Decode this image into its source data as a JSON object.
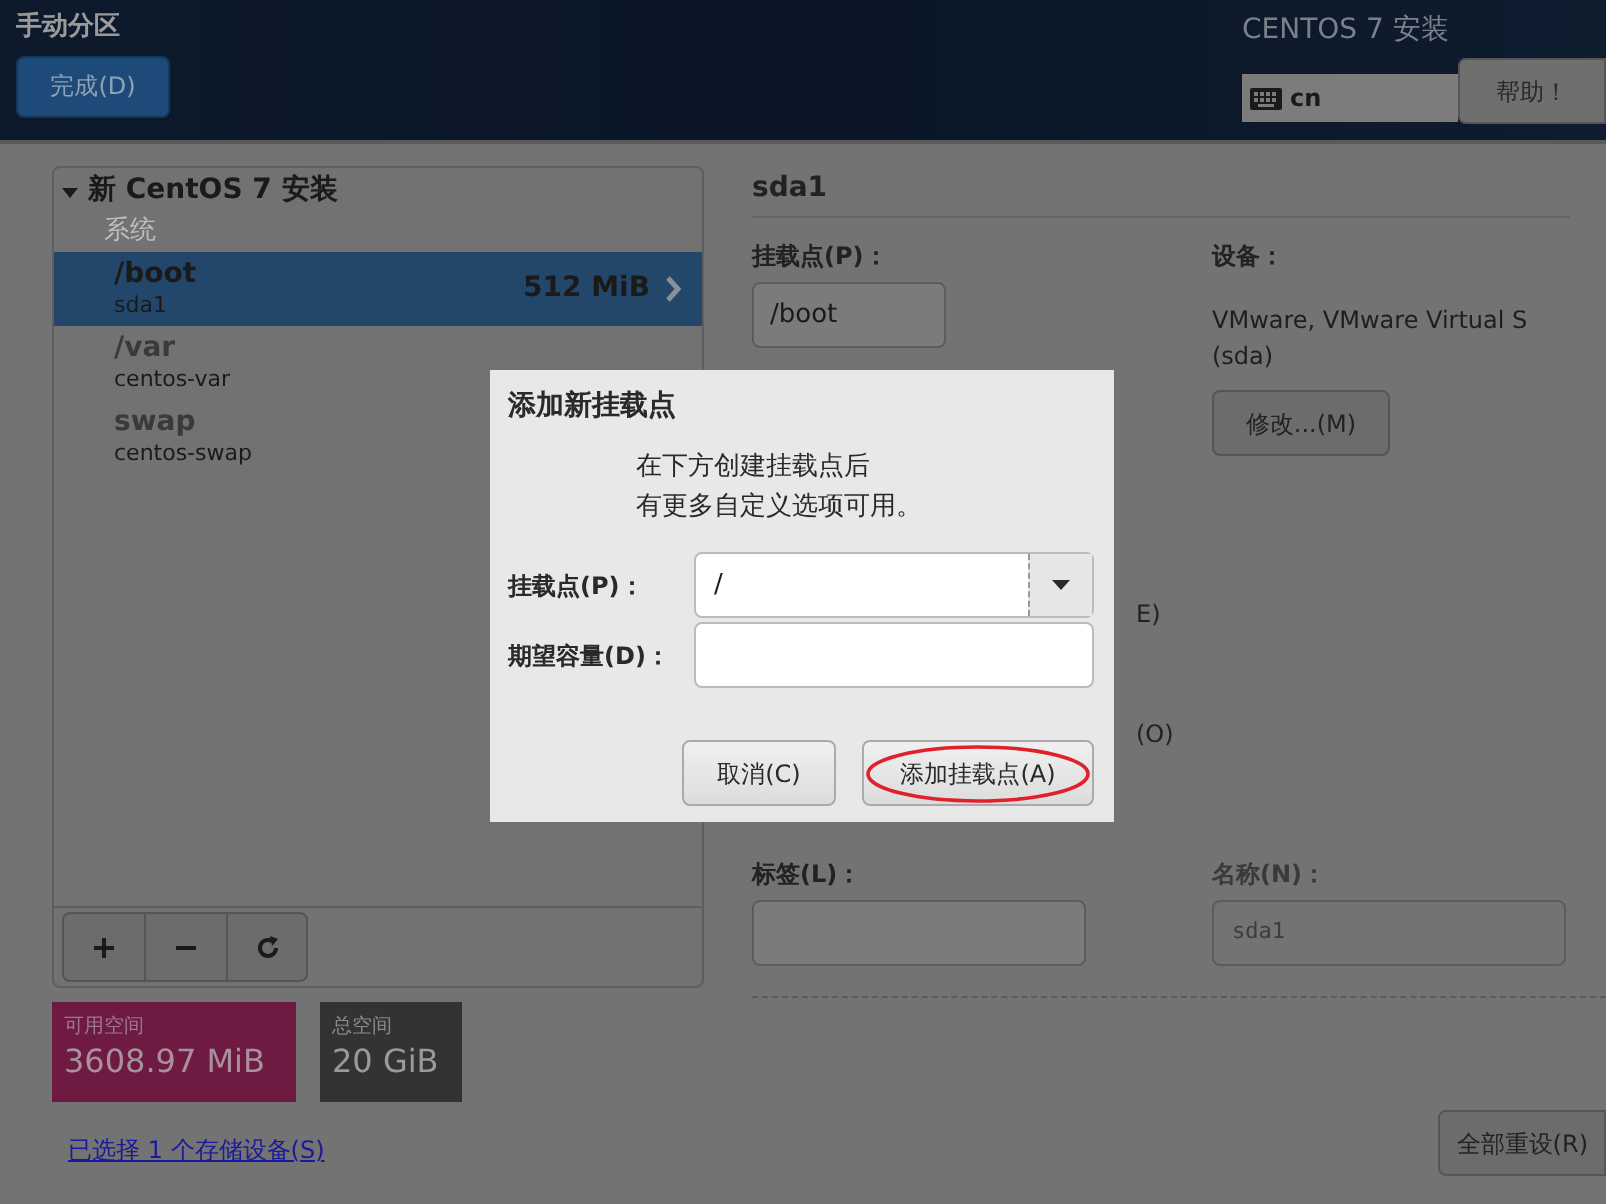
{
  "header": {
    "title": "手动分区",
    "done_button": "完成(D)",
    "product_title": "CENTOS 7 安装",
    "keyboard_layout": "cn",
    "help_button": "帮助！"
  },
  "partitions": {
    "group_title": "新 CentOS 7 安装",
    "expanded": true,
    "section_label": "系统",
    "items": [
      {
        "mount": "/boot",
        "device": "sda1",
        "size": "512 MiB",
        "selected": true
      },
      {
        "mount": "/var",
        "device": "centos-var",
        "selected": false
      },
      {
        "mount": "swap",
        "device": "centos-swap",
        "selected": false
      }
    ]
  },
  "space": {
    "available_label": "可用空间",
    "available_value": "3608.97 MiB",
    "total_label": "总空间",
    "total_value": "20 GiB"
  },
  "storage_link": "已选择 1 个存储设备(S)",
  "details": {
    "heading": "sda1",
    "mount_label": "挂载点(P)：",
    "mount_value": "/boot",
    "device_label": "设备：",
    "device_lines": [
      "VMware, VMware Virtual S",
      "(sda)"
    ],
    "modify_button": "修改...(M)",
    "fragments": [
      "E)",
      "(O)"
    ],
    "label_label": "标签(L)：",
    "name_label": "名称(N)：",
    "name_value": "sda1"
  },
  "reset_button": "全部重设(R)",
  "dialog": {
    "title": "添加新挂载点",
    "message_lines": [
      "在下方创建挂载点后",
      "有更多自定义选项可用。"
    ],
    "mount_label": "挂载点(P)：",
    "mount_value": "/",
    "size_label": "期望容量(D)：",
    "cancel_button": "取消(C)",
    "add_button": "添加挂载点(A)"
  }
}
